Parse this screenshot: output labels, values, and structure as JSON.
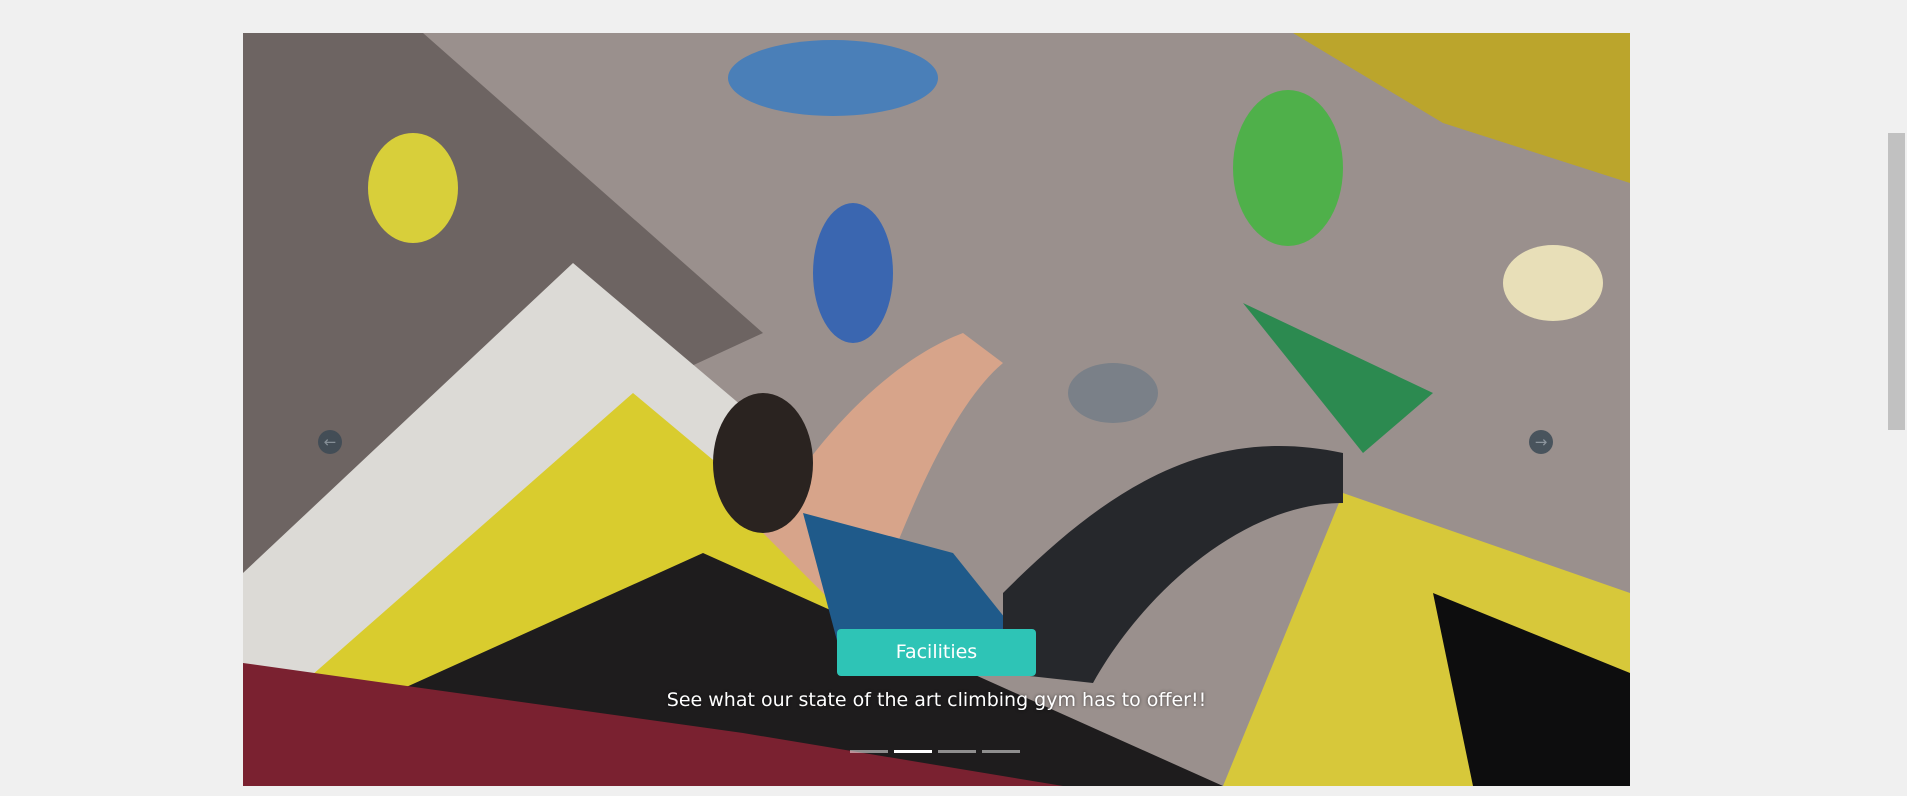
{
  "carousel": {
    "image_alt": "Climber on a bouldering wall",
    "button_label": "Facilities",
    "caption": "See what our state of the art climbing gym has to offer!!",
    "prev_icon": "arrow-left-circle-icon",
    "next_icon": "arrow-right-circle-icon",
    "slide_count": 4,
    "active_slide": 2,
    "accent_color": "#2ec4b6"
  }
}
